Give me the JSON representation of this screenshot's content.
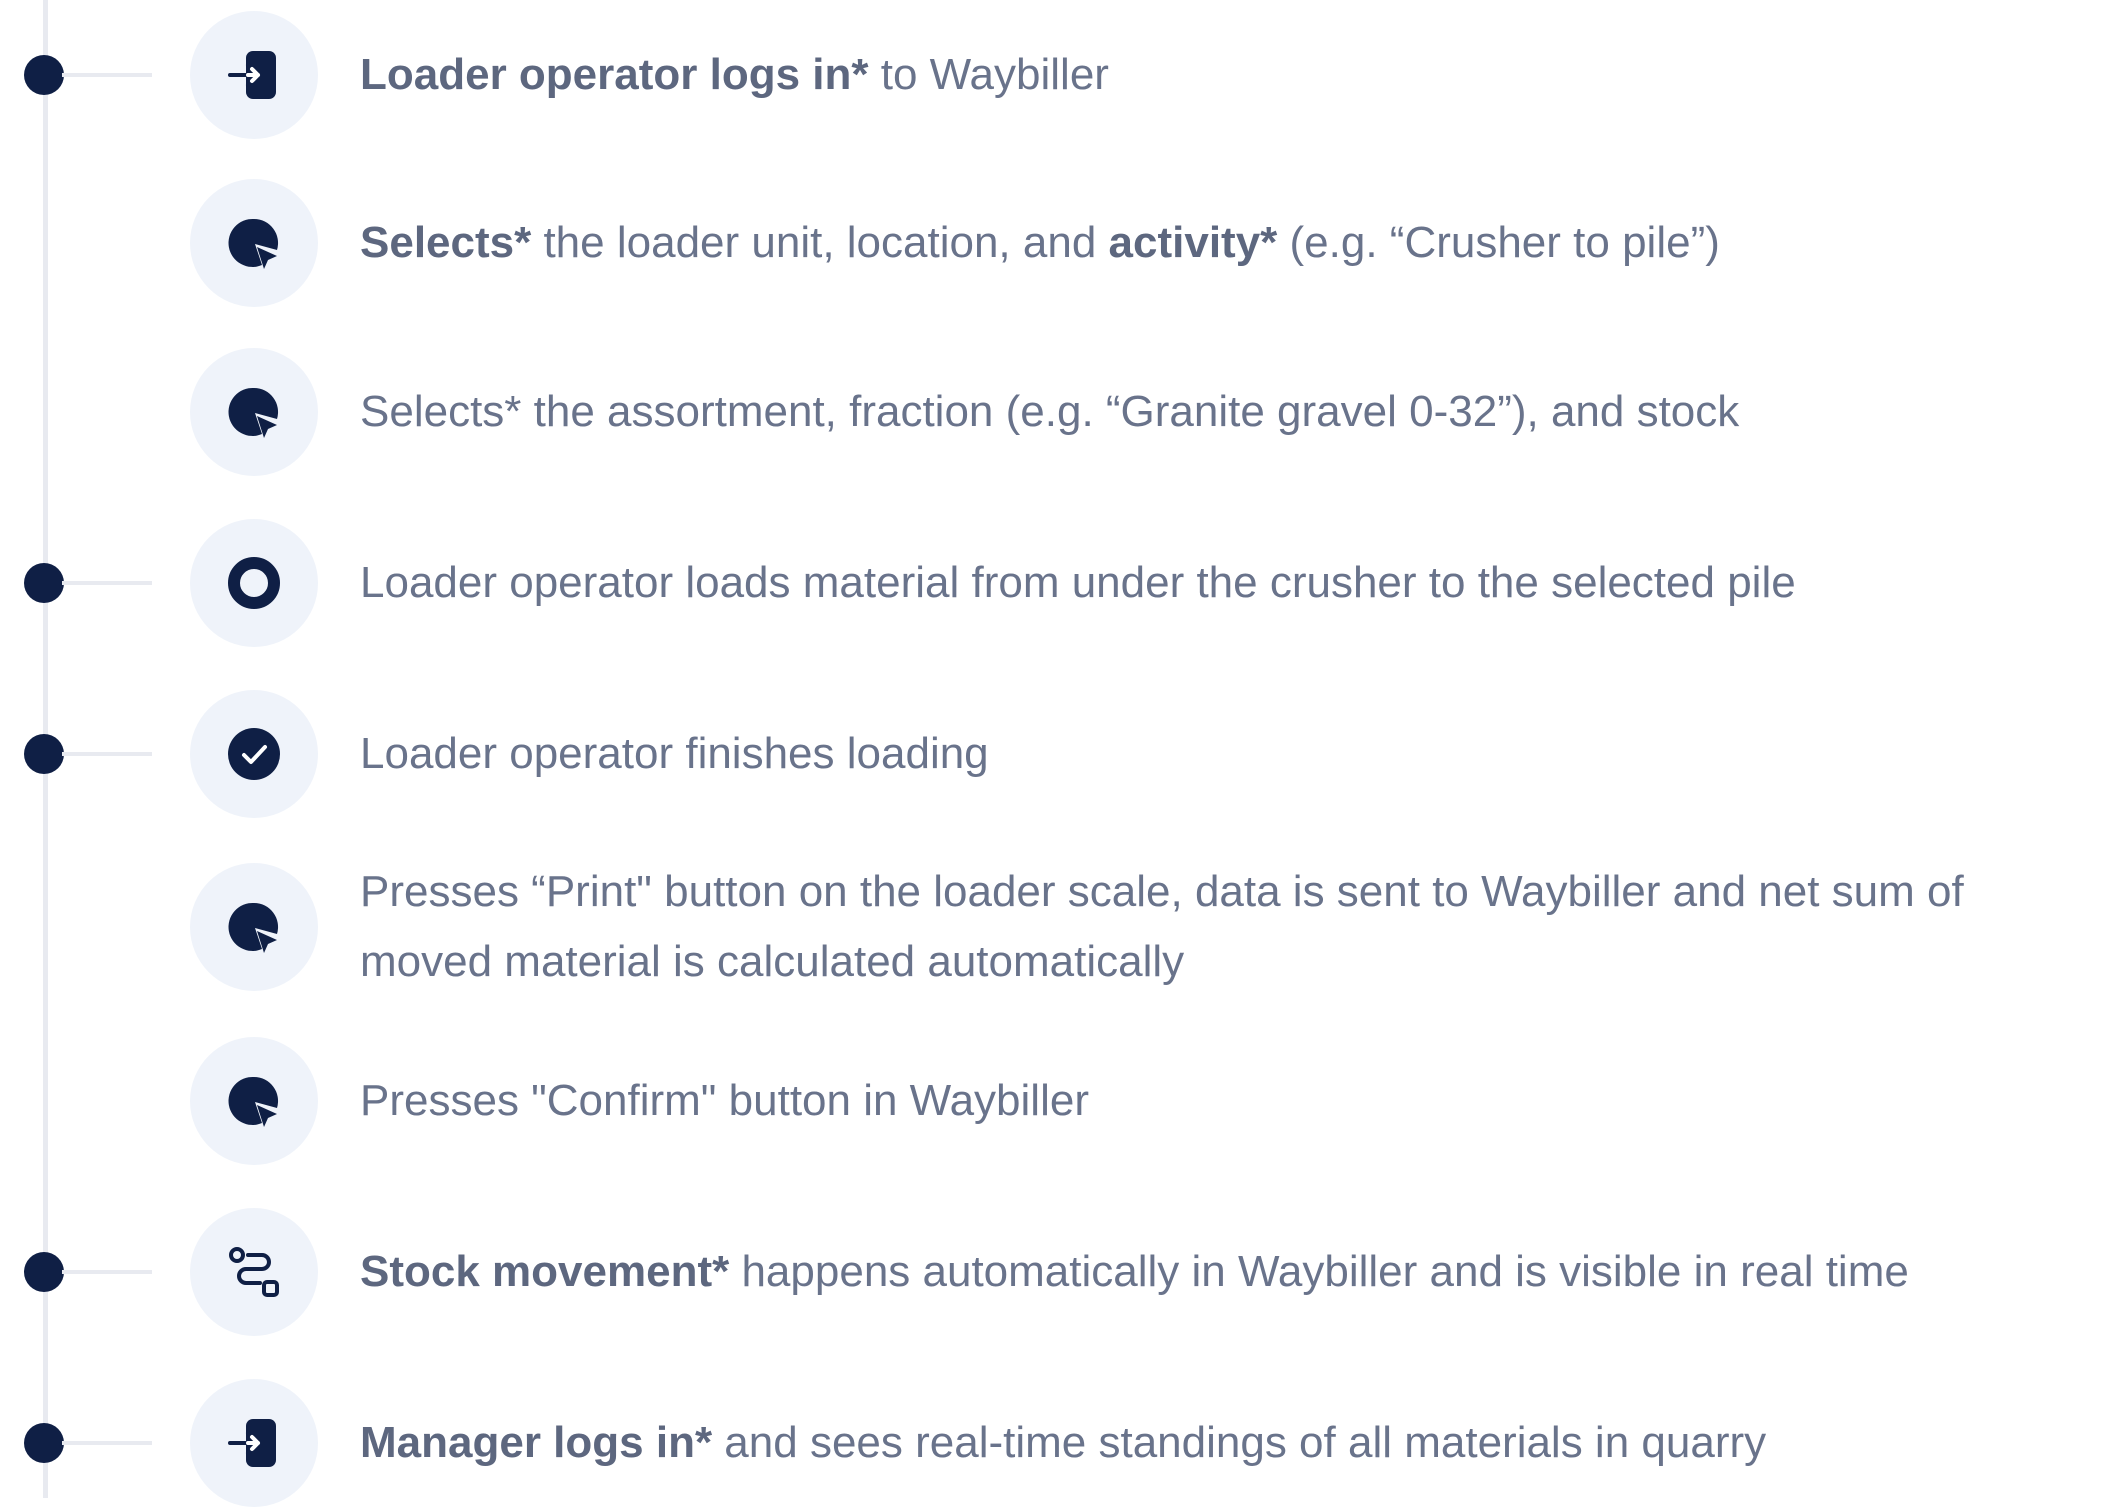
{
  "colors": {
    "dot": "#0f1f45",
    "icon": "#0f1f45",
    "icon_bg": "#eff3fa",
    "rail": "#e8eaf0",
    "text": "#69738b"
  },
  "steps": [
    {
      "icon": "login-icon",
      "milestone": true,
      "parts": [
        {
          "text": "Loader operator logs in*",
          "bold": true
        },
        {
          "text": " to Waybiller",
          "bold": false
        }
      ]
    },
    {
      "icon": "pointer-click-icon",
      "milestone": false,
      "parts": [
        {
          "text": "Selects*",
          "bold": true
        },
        {
          "text": " the loader unit, location, and ",
          "bold": false
        },
        {
          "text": "activity*",
          "bold": true
        },
        {
          "text": " (e.g. “Crusher to pile”)",
          "bold": false
        }
      ]
    },
    {
      "icon": "pointer-click-icon",
      "milestone": false,
      "parts": [
        {
          "text": "Selects* the assortment, fraction (e.g. “Granite gravel 0-32”), and stock",
          "bold": false
        }
      ]
    },
    {
      "icon": "record-icon",
      "milestone": true,
      "parts": [
        {
          "text": "Loader operator loads material from under the crusher to the selected pile",
          "bold": false
        }
      ]
    },
    {
      "icon": "check-circle-icon",
      "milestone": true,
      "parts": [
        {
          "text": "Loader operator finishes loading",
          "bold": false
        }
      ]
    },
    {
      "icon": "pointer-click-icon",
      "milestone": false,
      "parts": [
        {
          "text": "Presses “Print\" button on the loader scale, data is sent to Waybiller and net sum of moved material is calculated automatically",
          "bold": false
        }
      ]
    },
    {
      "icon": "pointer-click-icon",
      "milestone": false,
      "parts": [
        {
          "text": "Presses \"Confirm\" button in Waybiller",
          "bold": false
        }
      ]
    },
    {
      "icon": "route-icon",
      "milestone": true,
      "parts": [
        {
          "text": "Stock movement*",
          "bold": true
        },
        {
          "text": " happens automatically in Waybiller and is visible in real time",
          "bold": false
        }
      ]
    },
    {
      "icon": "login-icon",
      "milestone": true,
      "parts": [
        {
          "text": "Manager logs in*",
          "bold": true
        },
        {
          "text": " and sees real-time standings of all materials in quarry",
          "bold": false
        }
      ]
    }
  ]
}
